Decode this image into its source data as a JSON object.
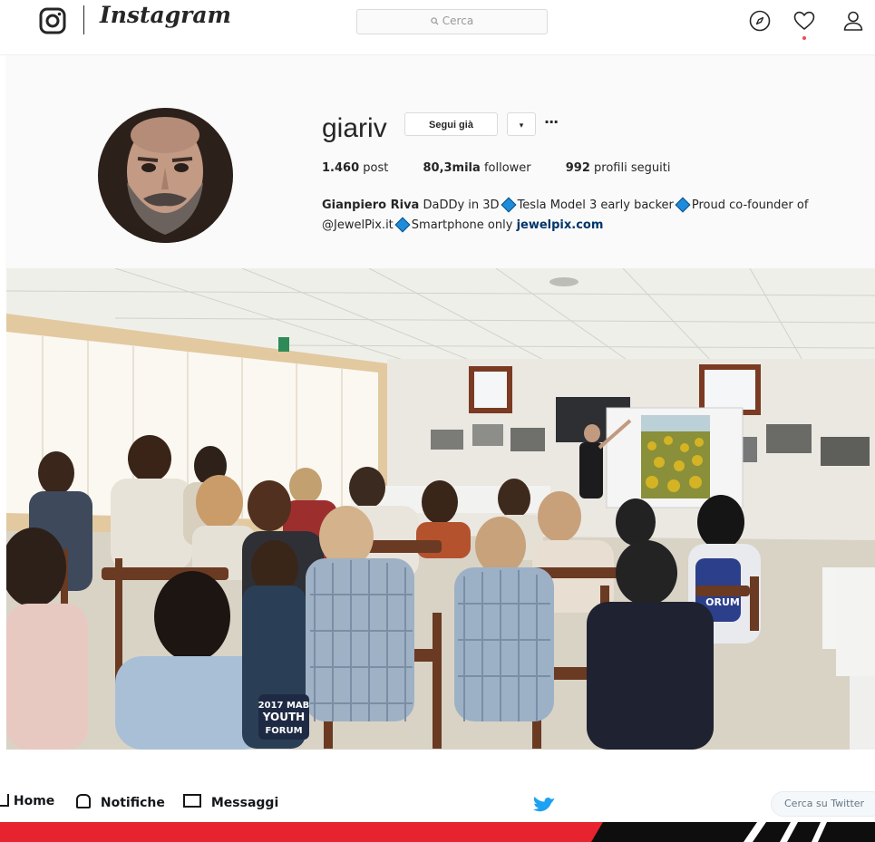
{
  "header": {
    "logo_text": "Instagram",
    "search_placeholder": "Cerca",
    "icons": [
      "instagram-glyph-icon",
      "search-icon",
      "compass-icon",
      "heart-icon",
      "profile-icon"
    ]
  },
  "profile": {
    "username": "giariv",
    "follow_button": "Segui già",
    "dropdown_symbol": "▾",
    "more_symbol": "···",
    "stats": [
      {
        "value": "1.460",
        "label": "post"
      },
      {
        "value": "80,3mila",
        "label": "follower"
      },
      {
        "value": "992",
        "label": "profili seguiti"
      }
    ],
    "bio": {
      "name": "Gianpiero Riva",
      "part1": "DaDDy in 3D",
      "part2": "Tesla Model 3 early backer",
      "part3": "Proud co-founder of @JewelPix.it",
      "part4": "Smartphone only",
      "link": "jewelpix.com"
    }
  },
  "photo": {
    "poster_labels": [
      "2017 MAB YOUTH FORUM",
      "ORUM"
    ]
  },
  "twitter_nav": {
    "items": [
      "Home",
      "Notifiche",
      "Messaggi"
    ],
    "search_placeholder": "Cerca su Twitter"
  },
  "colors": {
    "instagram_text": "#262626",
    "link": "#003569",
    "diamond": "#1d8cdc",
    "notification_dot": "#ed4956",
    "twitter_blue": "#1da1f2",
    "banner_red": "#e6232f"
  }
}
